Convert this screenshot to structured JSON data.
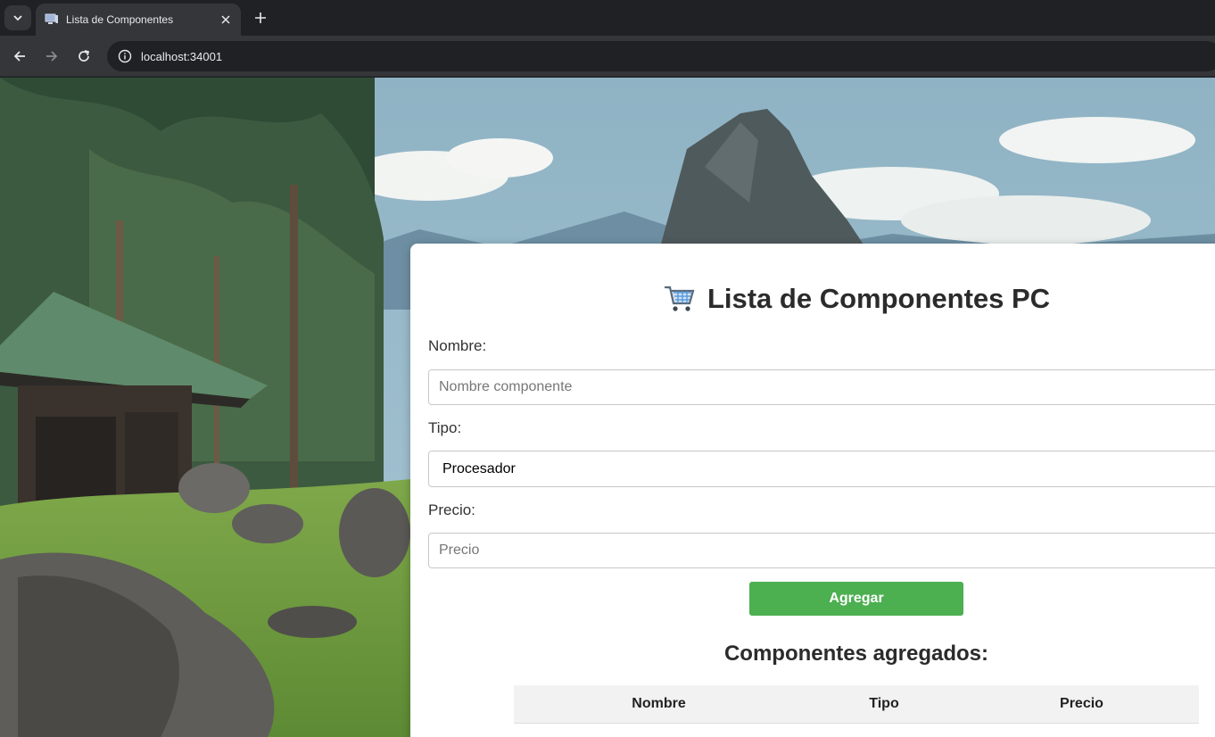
{
  "browser": {
    "tab_title": "Lista de Componentes",
    "url": "localhost:34001",
    "icons": {
      "tab_menu": "chevron-down-icon",
      "favicon": "monitor-icon",
      "close": "close-icon",
      "new_tab": "plus-icon",
      "back": "arrow-left-icon",
      "forward": "arrow-right-icon",
      "reload": "reload-icon",
      "site_info": "info-icon"
    }
  },
  "app": {
    "title": "Lista de Componentes PC",
    "title_icon": "shopping-cart-icon",
    "form": {
      "name_label": "Nombre:",
      "name_placeholder": "Nombre componente",
      "type_label": "Tipo:",
      "type_selected": "Procesador",
      "price_label": "Precio:",
      "price_placeholder": "Precio",
      "add_button": "Agregar"
    },
    "list_title": "Componentes agregados:",
    "table": {
      "headers": [
        "Nombre",
        "Tipo",
        "Precio"
      ]
    },
    "colors": {
      "accent": "#4caf50",
      "header_bg": "#f2f2f2",
      "text": "#2b2b2b"
    }
  }
}
